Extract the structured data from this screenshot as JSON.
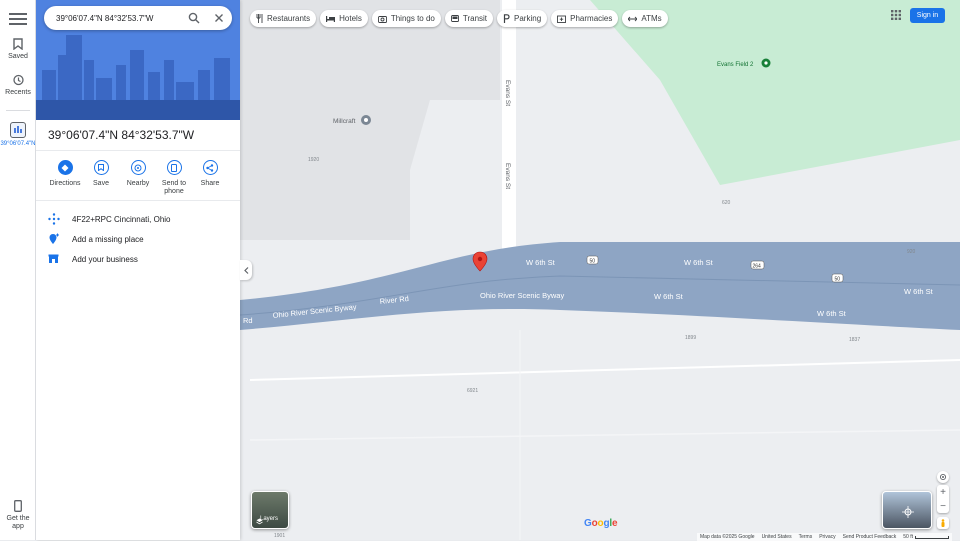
{
  "search": {
    "value": "39°06'07.4\"N 84°32'53.7\"W"
  },
  "rail": {
    "saved": "Saved",
    "recents": "Recents",
    "recent_item": "39°06'07.4\"N",
    "get_app": "Get the app"
  },
  "place": {
    "title": "39°06'07.4\"N 84°32'53.7\"W",
    "actions": [
      {
        "label": "Directions"
      },
      {
        "label": "Save"
      },
      {
        "label": "Nearby"
      },
      {
        "label": "Send to phone"
      },
      {
        "label": "Share"
      }
    ],
    "plus_code": "4F22+RPC Cincinnati, Ohio",
    "add_missing": "Add a missing place",
    "add_business": "Add your business"
  },
  "chips": [
    "Restaurants",
    "Hotels",
    "Things to do",
    "Transit",
    "Parking",
    "Pharmacies",
    "ATMs"
  ],
  "header": {
    "sign_in": "Sign in"
  },
  "map": {
    "labels": {
      "evans_field": "Evans Field 2",
      "millcraft": "Millcraft",
      "evans_st_1": "Evans St",
      "evans_st_2": "Evans St",
      "w6th_1": "W 6th St",
      "w6th_2": "W 6th St",
      "w6th_3": "W 6th St",
      "w6th_4": "W 6th St",
      "w6th_5": "W 6th St",
      "ohio_scenic_1": "Ohio River Scenic Byway",
      "ohio_scenic_2": "Ohio River Scenic Byway",
      "river_rd_1": "River Rd",
      "river_rd_2": "Rd",
      "shield_50_a": "50",
      "shield_264": "264",
      "shield_50_b": "50",
      "n1920": "1920",
      "n620": "620",
      "n920": "920",
      "n1899": "1899",
      "n1837": "1837",
      "n6921": "6921",
      "n1901": "1901"
    },
    "colors": {
      "road": "#8ea5c4",
      "park": "#c8ecd4",
      "pin": "#ea4335"
    }
  },
  "layers": {
    "label": "Layers"
  },
  "footer": {
    "mapdata": "Map data ©2025 Google",
    "country": "United States",
    "terms": "Terms",
    "privacy": "Privacy",
    "feedback": "Send Product Feedback",
    "scale": "50 ft"
  },
  "logo": "Google"
}
